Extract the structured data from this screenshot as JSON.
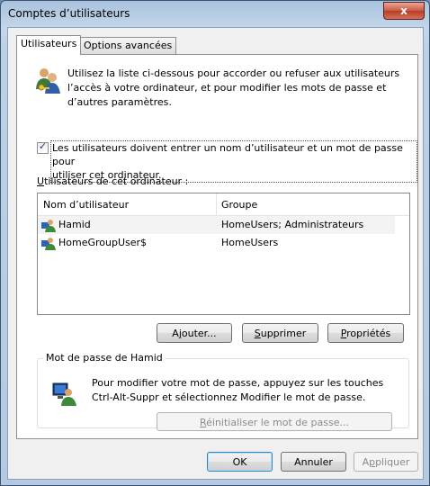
{
  "window": {
    "title": "Comptes d’utilisateurs",
    "close_glyph": "x"
  },
  "tabs": [
    {
      "label": "Utilisateurs",
      "active": true
    },
    {
      "label": "Options avancées",
      "active": false
    }
  ],
  "intro": {
    "text_lines": [
      "Utilisez la liste ci-dessous pour accorder ou refuser aux utilisateurs",
      "l’accès à votre ordinateur, et pour modifier les mots de passe et",
      "d’autres paramètres."
    ],
    "icon": "users-icon"
  },
  "require_password": {
    "checked": true,
    "check_glyph": "✓",
    "label_lines": [
      "Les utilisateurs doivent entrer un nom d’utilisateur et un mot de passe pour",
      "utiliser cet ordinateur."
    ]
  },
  "users_section": {
    "label_first": "U",
    "label_rest": "tilisateurs de cet ordinateur :",
    "columns": [
      "Nom d’utilisateur",
      "Groupe"
    ],
    "rows": [
      {
        "name": "Hamid",
        "group": "HomeUsers; Administrateurs",
        "selected": true
      },
      {
        "name": "HomeGroupUser$",
        "group": "HomeUsers",
        "selected": false
      }
    ]
  },
  "buttons": {
    "add": {
      "pre": "A",
      "ul": "j",
      "post": "outer..."
    },
    "remove": {
      "pre": "",
      "ul": "S",
      "post": "upprimer"
    },
    "properties": {
      "pre": "",
      "ul": "P",
      "post": "ropriétés"
    }
  },
  "password_group": {
    "title": "Mot de passe de Hamid",
    "text_lines": [
      "Pour modifier votre mot de passe, appuyez sur les touches",
      "Ctrl-Alt-Suppr et sélectionnez Modifier le mot de passe."
    ],
    "reset": {
      "pre": "",
      "ul": "R",
      "post": "éinitialiser le mot de passe..."
    }
  },
  "footer": {
    "ok": "OK",
    "cancel": "Annuler",
    "apply": {
      "pre": "A",
      "ul": "p",
      "post": "pliquer"
    }
  },
  "colors": {
    "accent": "#3c7fb1",
    "title_bar": "#b5cae2"
  }
}
